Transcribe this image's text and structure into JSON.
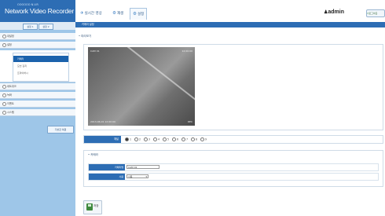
{
  "brand": {
    "subtitle": "OOOOOO N.V.R",
    "title": "Network Video Recorder"
  },
  "sidebar": {
    "tabs": [
      "설정 1",
      "설정 2"
    ],
    "sections": [
      "내설정",
      "설정",
      "네트워크",
      "녹화",
      "이벤트",
      "시스템"
    ],
    "sub_items": [
      "카메라",
      "모션 감지",
      "프라이버시"
    ],
    "bottom_button": "기본값 복원"
  },
  "nav": {
    "tabs": [
      {
        "label": "실시간 영상",
        "glyph": "✈"
      },
      {
        "label": "재생",
        "glyph": "⚙"
      },
      {
        "label": "설정",
        "glyph": "⚙"
      }
    ],
    "user": "admin",
    "logout": "로그아웃"
  },
  "page": {
    "header": "카메라 설정",
    "preview_section": "미리보기",
    "settings_section": "카메라"
  },
  "video": {
    "top_left": "CAM 01",
    "top_right": "12:00:00",
    "bottom_left": "2013-06-01 12:00:00",
    "bottom_right": "REC"
  },
  "channel": {
    "label": "채널",
    "options": [
      "1",
      "2",
      "3",
      "4",
      "5",
      "6",
      "7",
      "8",
      "9"
    ],
    "selected": "1"
  },
  "fields": [
    {
      "label": "카메라명",
      "value": "CAM 01",
      "type": "text"
    },
    {
      "label": "사용",
      "value": "사용",
      "type": "select"
    }
  ],
  "save_label": "저장",
  "colors": {
    "primary": "#2d6db4",
    "sidebar_bg": "#9ec6e8",
    "active_item": "#1b62ac"
  }
}
